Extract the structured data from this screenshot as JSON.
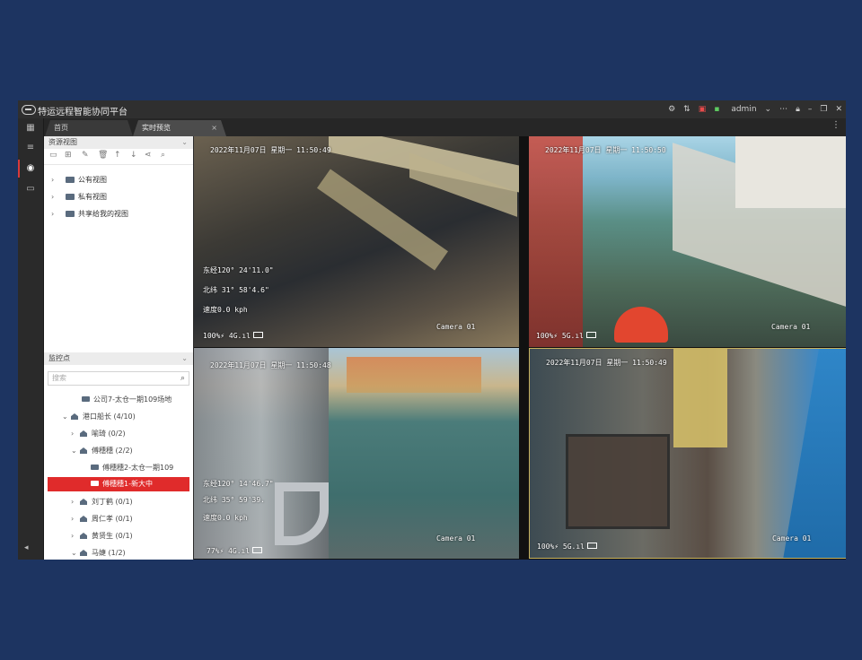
{
  "app": {
    "title": "特运远程智能协同平台",
    "user": "admin",
    "toolbar_icons": [
      "gear-icon",
      "sort-icon",
      "record-icon",
      "screen-icon",
      "chevron-down-icon",
      "more-icon",
      "lock-icon",
      "minimize-icon",
      "restore-icon",
      "close-icon"
    ]
  },
  "tabs": [
    {
      "label": "首页"
    },
    {
      "label": "实时预览",
      "active": true
    }
  ],
  "resource_panel": {
    "title": "资源视图",
    "views": [
      {
        "label": "公有视图"
      },
      {
        "label": "私有视图"
      },
      {
        "label": "共享给我的视图"
      }
    ]
  },
  "monitor_panel": {
    "title": "监控点",
    "search_placeholder": "搜索",
    "items": [
      {
        "label": "公司7-太仓一期109场地",
        "type": "camera"
      },
      {
        "label": "港口船长",
        "count": "(4/10)",
        "type": "group",
        "expanded": true
      },
      {
        "label": "喻琦",
        "count": "(0/2)",
        "type": "group"
      },
      {
        "label": "傅穗穗",
        "count": "(2/2)",
        "type": "group",
        "expanded": true
      },
      {
        "label": "傅穗穗2-太仓一期109",
        "type": "camera"
      },
      {
        "label": "傅穗穗1-新大中",
        "type": "camera",
        "selected": true
      },
      {
        "label": "刘丁鹤",
        "count": "(0/1)",
        "type": "group"
      },
      {
        "label": "周仁孝",
        "count": "(0/1)",
        "type": "group"
      },
      {
        "label": "黄贤生",
        "count": "(0/1)",
        "type": "group"
      },
      {
        "label": "马婕",
        "count": "(1/2)",
        "type": "group"
      }
    ]
  },
  "video": {
    "cells": [
      {
        "timestamp": "2022年11月07日 星期一 11:50:49",
        "lon": "东经120° 24'11.0\"",
        "lat": "北纬 31° 58'4.6\"",
        "speed": "速度0.0 kph",
        "signal": "100%⚡ 4G.ıl",
        "camera": "Camera 01"
      },
      {
        "timestamp": "2022年11月07日 星期一 11:50:50",
        "signal": "100%⚡ 5G.ıl",
        "camera": "Camera 01"
      },
      {
        "timestamp": "2022年11月07日 星期一 11:50:48",
        "lon": "东经120° 14'46.7\"",
        "lat": "北纬 35° 59'39.",
        "speed": "速度0.0 kph",
        "signal": "77%⚡ 4G.ıl",
        "camera": "Camera 01"
      },
      {
        "timestamp": "2022年11月07日 星期一 11:50:49",
        "signal": "100%⚡ 5G.ıl",
        "camera": "Camera 01"
      }
    ]
  }
}
